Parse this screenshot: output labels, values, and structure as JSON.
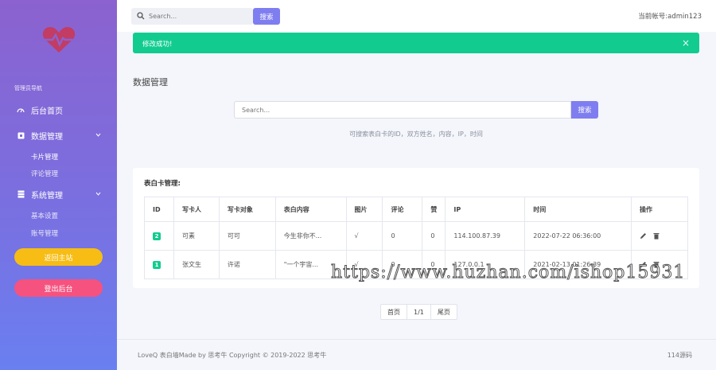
{
  "sidebar": {
    "logo_icon": "heartbeat-icon",
    "nav_title": "管理员导航",
    "home": {
      "label": "后台首页",
      "icon": "dashboard-icon"
    },
    "data_group": {
      "label": "数据管理",
      "icon": "square-icon",
      "items": [
        {
          "label": "卡片管理"
        },
        {
          "label": "评论管理"
        }
      ]
    },
    "system_group": {
      "label": "系统管理",
      "icon": "database-icon",
      "items": [
        {
          "label": "基本设置"
        },
        {
          "label": "账号管理"
        }
      ]
    },
    "back_site_label": "返回主站",
    "logout_label": "登出后台",
    "colors": {
      "gradient_top": "#8b62cf",
      "gradient_bottom": "#6a7ff0",
      "home_btn": "#f7bd14",
      "logout_btn": "#f5527f"
    }
  },
  "topbar": {
    "search_placeholder": "Search...",
    "search_button": "搜索",
    "account_text": "当前帐号:admin123"
  },
  "alert": {
    "message": "修改成功!",
    "close": "×",
    "color": "#12cc8f"
  },
  "main": {
    "title": "数据管理",
    "search_placeholder": "Search...",
    "search_button": "搜索",
    "hint": "可搜索表白卡的ID，双方姓名，内容，IP，时间"
  },
  "table": {
    "title": "表白卡管理:",
    "headers": [
      "ID",
      "写卡人",
      "写卡对象",
      "表白内容",
      "图片",
      "评论",
      "赞",
      "IP",
      "时间",
      "操作"
    ],
    "rows": [
      {
        "id": "2",
        "writer": "可素",
        "target": "可可",
        "content": "今生非你不...",
        "image": "√",
        "comments": "0",
        "likes": "0",
        "ip": "114.100.87.39",
        "time": "2022-07-22 06:36:00"
      },
      {
        "id": "1",
        "writer": "张文生",
        "target": "许诺",
        "content": "\"一个宇宙...",
        "image": "√",
        "comments": "0",
        "likes": "0",
        "ip": "127.0.0.1",
        "time": "2021-02-13 01:26:39"
      }
    ]
  },
  "pagination": {
    "first": "首页",
    "current": "1/1",
    "last": "尾页"
  },
  "footer": {
    "left": "LoveQ 表白墙Made by 思考牛 Copyright © 2019-2022 思考牛",
    "right": "114源码"
  },
  "watermark": "https://www.huzhan.com/ishop15931",
  "accent_color": "#7f7ef0"
}
